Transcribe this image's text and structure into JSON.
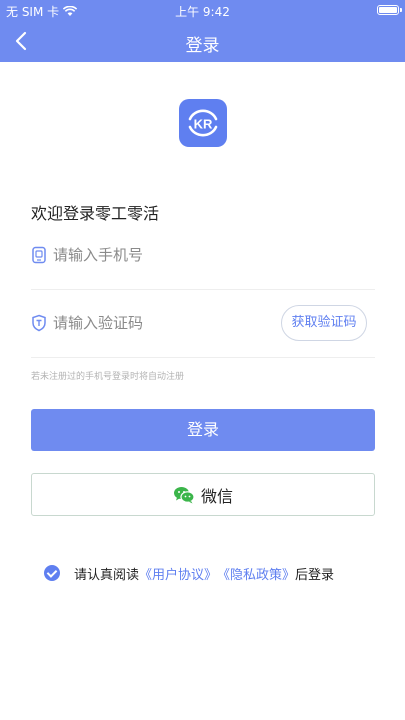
{
  "status_bar": {
    "carrier": "无 SIM 卡",
    "time": "上午 9:42"
  },
  "nav": {
    "title": "登录"
  },
  "logo": {
    "text": "KR"
  },
  "welcome": "欢迎登录零工零活",
  "phone_field": {
    "placeholder": "请输入手机号",
    "value": ""
  },
  "code_field": {
    "placeholder": "请输入验证码",
    "value": "",
    "button": "获取验证码"
  },
  "hint": "若未注册过的手机号登录时将自动注册",
  "login_button": "登录",
  "wechat_button": "微信",
  "agreement": {
    "prefix": "请认真阅读",
    "user_agreement": "《用户协议》",
    "privacy_policy": "《隐私政策》",
    "suffix": "后登录",
    "checked": true
  },
  "colors": {
    "primary": "#6f8bf0",
    "wechat_green": "#3bb54a"
  },
  "icons": [
    "back-icon",
    "wifi-icon",
    "battery-icon",
    "phone-icon",
    "shield-icon",
    "wechat-icon",
    "checkbox-icon"
  ]
}
